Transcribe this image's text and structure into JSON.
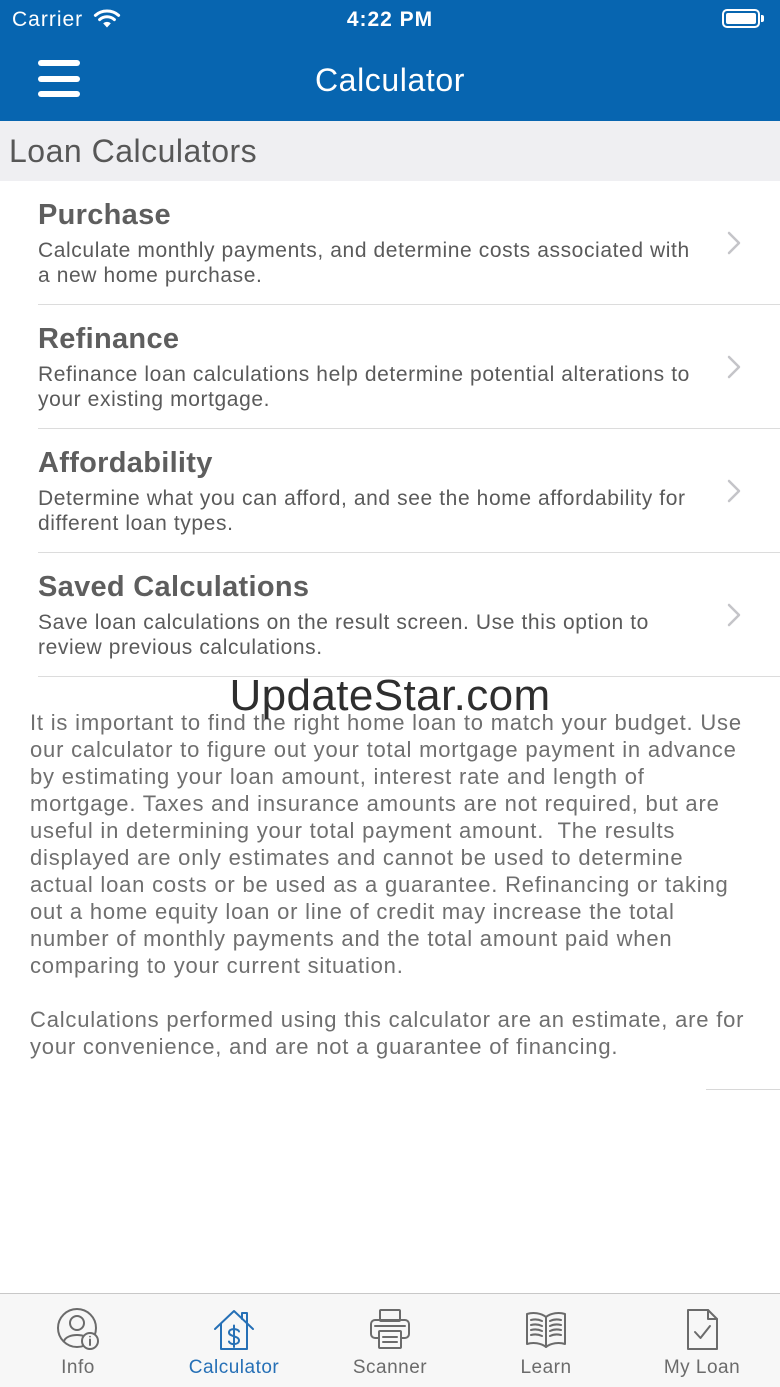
{
  "status_bar": {
    "carrier": "Carrier",
    "time": "4:22 PM",
    "battery_level": 1.0,
    "wifi_icon": "wifi-icon",
    "battery_icon": "battery-icon"
  },
  "nav_bar": {
    "title": "Calculator",
    "menu_icon": "hamburger-menu-icon"
  },
  "section": {
    "title": "Loan Calculators"
  },
  "calculators": [
    {
      "title": "Purchase",
      "description": "Calculate monthly payments, and determine costs associated with a new home purchase.",
      "icon": "chevron-right-icon"
    },
    {
      "title": "Refinance",
      "description": "Refinance loan calculations help determine potential alterations to your existing mortgage.",
      "icon": "chevron-right-icon"
    },
    {
      "title": "Affordability",
      "description": "Determine what you can afford, and see the home affordability for different loan types.",
      "icon": "chevron-right-icon"
    },
    {
      "title": "Saved Calculations",
      "description": "Save loan calculations on the result screen. Use this option to review previous calculations.",
      "icon": "chevron-right-icon"
    }
  ],
  "watermark": "UpdateStar.com",
  "disclaimer": {
    "paragraphs": [
      "It is important to find the right home loan to match your budget. Use our calculator to figure out your total mortgage payment in advance by estimating your loan amount, interest rate and length of mortgage. Taxes and insurance amounts are not required, but are useful in determining your total payment amount.  The results displayed are only estimates and cannot be used to determine actual loan costs or be used as a guarantee. Refinancing or taking out a home equity loan or line of credit may increase the total number of monthly payments and the total amount paid when comparing to your current situation.",
      "Calculations performed using this calculator are an estimate, are for your convenience, and are not a guarantee of financing."
    ]
  },
  "tab_bar": {
    "items": [
      {
        "label": "Info",
        "icon": "person-info-icon",
        "active": false
      },
      {
        "label": "Calculator",
        "icon": "house-dollar-icon",
        "active": true
      },
      {
        "label": "Scanner",
        "icon": "printer-icon",
        "active": false
      },
      {
        "label": "Learn",
        "icon": "open-book-icon",
        "active": false
      },
      {
        "label": "My Loan",
        "icon": "document-check-icon",
        "active": false
      }
    ]
  },
  "colors": {
    "header_background": "#0765b0",
    "header_text": "#ffffff",
    "section_background": "#efeff2",
    "active_tab": "#2670b6",
    "inactive_tab": "#6b6b6b",
    "chevron": "#c4c4c8"
  }
}
